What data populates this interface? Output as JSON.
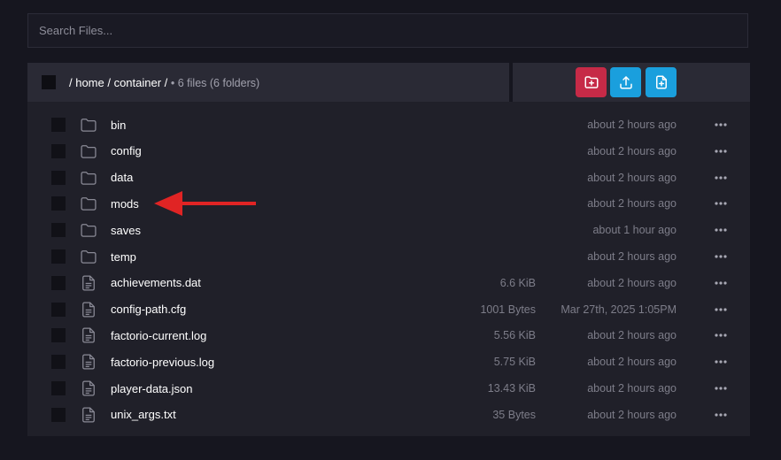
{
  "search": {
    "placeholder": "Search Files..."
  },
  "breadcrumb": {
    "path": "/ home / container /",
    "meta": "• 6 files (6 folders)"
  },
  "toolbar": {
    "new_folder_icon": "folder-plus-icon",
    "upload_icon": "upload-icon",
    "new_file_icon": "file-plus-icon",
    "colors": {
      "new_folder": "#c62a47",
      "upload": "#1a9fdd",
      "new_file": "#1a9fdd"
    }
  },
  "files": [
    {
      "name": "bin",
      "type": "folder",
      "size": "",
      "modified": "about 2 hours ago"
    },
    {
      "name": "config",
      "type": "folder",
      "size": "",
      "modified": "about 2 hours ago"
    },
    {
      "name": "data",
      "type": "folder",
      "size": "",
      "modified": "about 2 hours ago"
    },
    {
      "name": "mods",
      "type": "folder",
      "size": "",
      "modified": "about 2 hours ago"
    },
    {
      "name": "saves",
      "type": "folder",
      "size": "",
      "modified": "about 1 hour ago"
    },
    {
      "name": "temp",
      "type": "folder",
      "size": "",
      "modified": "about 2 hours ago"
    },
    {
      "name": "achievements.dat",
      "type": "file",
      "size": "6.6 KiB",
      "modified": "about 2 hours ago"
    },
    {
      "name": "config-path.cfg",
      "type": "file",
      "size": "1001 Bytes",
      "modified": "Mar 27th, 2025 1:05PM"
    },
    {
      "name": "factorio-current.log",
      "type": "file",
      "size": "5.56 KiB",
      "modified": "about 2 hours ago"
    },
    {
      "name": "factorio-previous.log",
      "type": "file",
      "size": "5.75 KiB",
      "modified": "about 2 hours ago"
    },
    {
      "name": "player-data.json",
      "type": "file",
      "size": "13.43 KiB",
      "modified": "about 2 hours ago"
    },
    {
      "name": "unix_args.txt",
      "type": "file",
      "size": "35 Bytes",
      "modified": "about 2 hours ago"
    }
  ],
  "annotation": {
    "arrow_icon": "red-arrow-icon",
    "color": "#e02424"
  }
}
